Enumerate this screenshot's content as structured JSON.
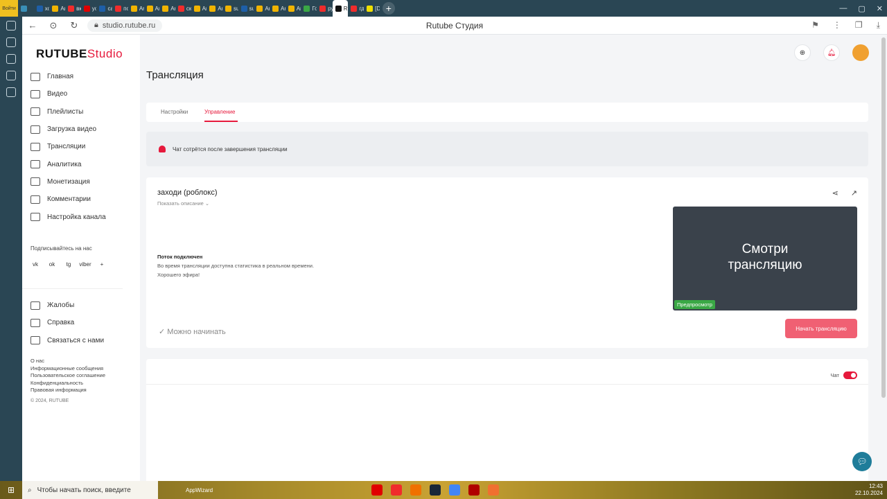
{
  "browser": {
    "tabs": [
      {
        "label": "",
        "color": "#3a8fb7"
      },
      {
        "label": "хос",
        "color": "#1e5fa8"
      },
      {
        "label": "Are",
        "color": "#f0b400"
      },
      {
        "label": "вкл",
        "color": "#f02c2c"
      },
      {
        "label": "you",
        "color": "#e00000"
      },
      {
        "label": "сап",
        "color": "#1e5fa8"
      },
      {
        "label": "пох",
        "color": "#f02c2c"
      },
      {
        "label": "Are",
        "color": "#f0b400"
      },
      {
        "label": "Are",
        "color": "#f0b400"
      },
      {
        "label": "Are",
        "color": "#f0b400"
      },
      {
        "label": "ска",
        "color": "#f02c2c"
      },
      {
        "label": "Are",
        "color": "#f0b400"
      },
      {
        "label": "Are",
        "color": "#f0b400"
      },
      {
        "label": "sup",
        "color": "#f0b400"
      },
      {
        "label": "sup",
        "color": "#1e5fa8"
      },
      {
        "label": "Are",
        "color": "#f0b400"
      },
      {
        "label": "Are",
        "color": "#f0b400"
      },
      {
        "label": "Are",
        "color": "#f0b400"
      },
      {
        "label": "Гог",
        "color": "#3aa845"
      },
      {
        "label": "руг",
        "color": "#f02c2c"
      },
      {
        "label": "R",
        "color": "#111111",
        "active": true
      },
      {
        "label": "где",
        "color": "#f02c2c"
      },
      {
        "label": "[Dc",
        "color": "#f0e000"
      }
    ],
    "url": "studio.rutube.ru",
    "page_title": "Rutube Студия"
  },
  "logo": {
    "main": "RUTUBE",
    "accent": "Studio"
  },
  "nav": {
    "items": [
      {
        "label": "Главная"
      },
      {
        "label": "Видео"
      },
      {
        "label": "Плейлисты"
      },
      {
        "label": "Загрузка видео"
      },
      {
        "label": "Трансляции"
      },
      {
        "label": "Аналитика"
      },
      {
        "label": "Монетизация"
      },
      {
        "label": "Комментарии"
      },
      {
        "label": "Настройка канала"
      }
    ],
    "follow_label": "Подписывайтесь на нас",
    "socials": [
      "vk",
      "ok",
      "tg",
      "viber",
      "+"
    ],
    "secondary": [
      {
        "label": "Жалобы"
      },
      {
        "label": "Справка"
      },
      {
        "label": "Связаться с нами"
      }
    ],
    "footer_links": [
      "О нас",
      "Информационные сообщения",
      "Пользовательское соглашение",
      "Конфиденциальность",
      "Правовая информация"
    ],
    "copyright": "© 2024, RUTUBE"
  },
  "main": {
    "title": "Трансляция",
    "tabs": [
      {
        "label": "Настройки"
      },
      {
        "label": "Управление",
        "active": true
      }
    ],
    "notice": "Чат сотрётся после завершения трансляции",
    "stream": {
      "name": "заходи (роблокс)",
      "show_description": "Показать описание",
      "status_title": "Поток подключен",
      "status_lines": [
        "Во время трансляции доступна статистика в реальном времени.",
        "Хорошего эфира!"
      ],
      "preview_text_1": "Смотри",
      "preview_text_2": "трансляцию",
      "preview_badge": "Предпросмотр",
      "ready_label": "Можно начинать",
      "start_button": "Начать трансляцию"
    },
    "chat": {
      "label": "Чат",
      "enabled": true
    }
  },
  "taskbar": {
    "search_placeholder": "Чтобы начать поиск, введите",
    "app": "AppWizard",
    "time": "12:43",
    "date": "22.10.2024",
    "lang": "РУС"
  },
  "colors": {
    "accent": "#e6193c",
    "button": "#f06073",
    "preview_badge": "#3aa845"
  }
}
